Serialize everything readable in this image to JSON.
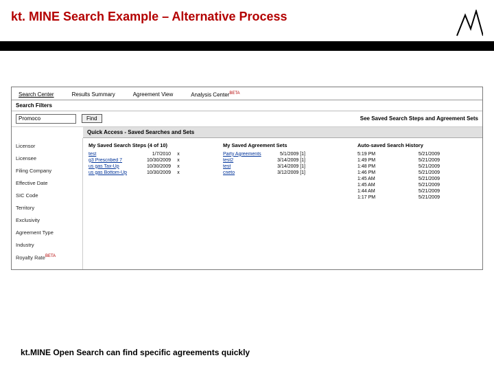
{
  "slide": {
    "title": "kt. MINE Search Example – Alternative Process",
    "footer": "kt.MINE Open Search can find specific agreements quickly"
  },
  "tabs": {
    "search_center": "Search Center",
    "results_summary": "Results Summary",
    "agreement_view": "Agreement View",
    "analysis_center": "Analysis Center",
    "beta": "BETA"
  },
  "search": {
    "filters_label": "Search Filters",
    "input_value": "Promoco",
    "find": "Find",
    "saved_link": "See Saved Search Steps and Agreement Sets",
    "quick_access": "Quick Access - Saved Searches and Sets"
  },
  "filters": {
    "licensor": "Licensor",
    "licensee": "Licensee",
    "filing_company": "Filing Company",
    "effective_date": "Effective Date",
    "sic_code": "SIC Code",
    "territory": "Territory",
    "exclusivity": "Exclusivity",
    "agreement_type": "Agreement Type",
    "industry": "Industry",
    "royalty_rate": "Royalty Rate",
    "beta": "BETA"
  },
  "columns": {
    "my_steps": "My Saved Search Steps (4 of 10)",
    "my_sets": "My Saved Agreement Sets",
    "auto_history": "Auto-saved Search History"
  },
  "steps": [
    {
      "name": "test",
      "date": "1/7/2010",
      "x": "x"
    },
    {
      "name": "g3 Prescribed 7",
      "date": "10/30/2009",
      "x": "x"
    },
    {
      "name": "us gas Tax-Up",
      "date": "10/30/2009",
      "x": "x"
    },
    {
      "name": "us gas Bottom-Up",
      "date": "10/30/2009",
      "x": "x"
    }
  ],
  "sets": [
    {
      "name": "Party Agreements",
      "date": "5/1/2009 [1]"
    },
    {
      "name": "test2",
      "date": "3/14/2009 [1]"
    },
    {
      "name": "test",
      "date": "3/14/2009 [1]"
    },
    {
      "name": "cneto",
      "date": "3/12/2009 [1]"
    }
  ],
  "history": [
    {
      "time": "5:19 PM",
      "date": "5/21/2009"
    },
    {
      "time": "1:49 PM",
      "date": "5/21/2009"
    },
    {
      "time": "1:48 PM",
      "date": "5/21/2009"
    },
    {
      "time": "1:46 PM",
      "date": "5/21/2009"
    },
    {
      "time": "1:45 AM",
      "date": "5/21/2009"
    },
    {
      "time": "1:45 AM",
      "date": "5/21/2009"
    },
    {
      "time": "1:44 AM",
      "date": "5/21/2009"
    },
    {
      "time": "1:17 PM",
      "date": "5/21/2009"
    }
  ]
}
